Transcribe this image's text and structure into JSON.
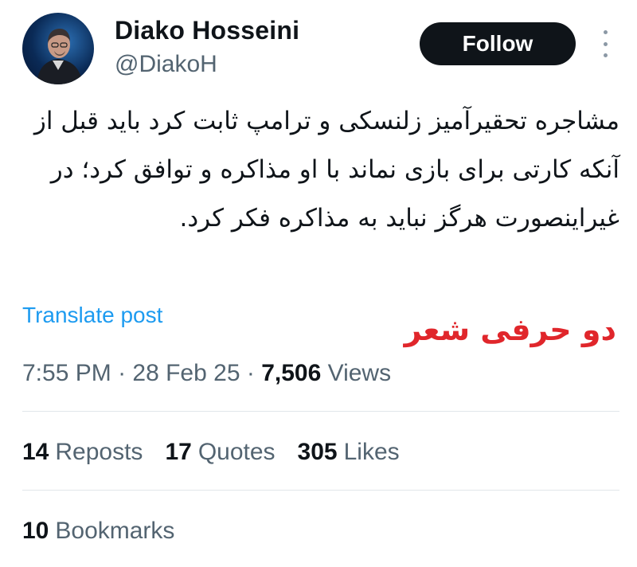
{
  "author": {
    "name": "Diako Hosseini",
    "handle": "@DiakoH"
  },
  "follow_label": "Follow",
  "tweet": {
    "text": "مشاجره تحقیرآمیز زلنسکی و ترامپ ثابت کرد باید قبل از آنکه کارتی برای بازی نماند با او مذاکره و توافق کرد؛ در غیراینصورت هرگز نباید به مذاکره فکر کرد.",
    "translate_label": "Translate post"
  },
  "overlay_text": "دو حرفی شعر",
  "meta": {
    "time": "7:55 PM",
    "separator": " · ",
    "date": "28 Feb 25",
    "views_count": "7,506",
    "views_label": "Views"
  },
  "stats": {
    "reposts_count": "14",
    "reposts_label": "Reposts",
    "quotes_count": "17",
    "quotes_label": "Quotes",
    "likes_count": "305",
    "likes_label": "Likes",
    "bookmarks_count": "10",
    "bookmarks_label": "Bookmarks"
  },
  "icons": {
    "more": "more-vertical-icon"
  },
  "colors": {
    "accent": "#1d9bf0",
    "overlay": "#e0262b",
    "button_bg": "#0f1419",
    "secondary_text": "#536471"
  }
}
